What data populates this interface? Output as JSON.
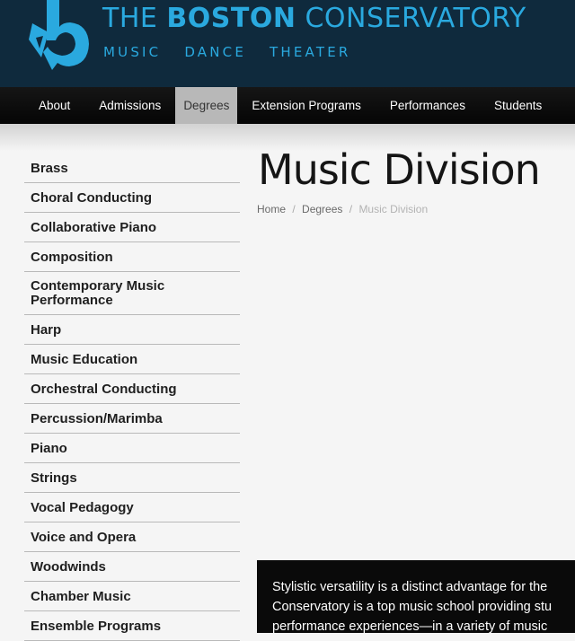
{
  "brand": {
    "name_prefix": "THE ",
    "name_bold": "BOSTON",
    "name_suffix": " CONSERVATORY",
    "tagline": [
      "MUSIC",
      "DANCE",
      "THEATER"
    ],
    "color": "#2aa9df"
  },
  "nav": {
    "items": [
      {
        "label": "About"
      },
      {
        "label": "Admissions"
      },
      {
        "label": "Degrees",
        "active": true
      },
      {
        "label": "Extension Programs"
      },
      {
        "label": "Performances"
      },
      {
        "label": "Students"
      }
    ]
  },
  "sidebar": {
    "items": [
      {
        "label": "Brass"
      },
      {
        "label": "Choral Conducting"
      },
      {
        "label": "Collaborative Piano"
      },
      {
        "label": "Composition"
      },
      {
        "label": "Contemporary Music Performance"
      },
      {
        "label": "Harp"
      },
      {
        "label": "Music Education"
      },
      {
        "label": "Orchestral Conducting"
      },
      {
        "label": "Percussion/Marimba"
      },
      {
        "label": "Piano"
      },
      {
        "label": "Strings"
      },
      {
        "label": "Vocal Pedagogy"
      },
      {
        "label": "Voice and Opera"
      },
      {
        "label": "Woodwinds"
      },
      {
        "label": "Chamber Music"
      },
      {
        "label": "Ensemble Programs"
      }
    ]
  },
  "main": {
    "title": "Music Division",
    "breadcrumb": {
      "home": "Home",
      "degrees": "Degrees",
      "current": "Music Division",
      "separator": "/"
    },
    "intro_lines": [
      "Stylistic versatility is a distinct advantage for the",
      "Conservatory is a top music school providing stu",
      "performance experiences—in a variety of music"
    ]
  }
}
